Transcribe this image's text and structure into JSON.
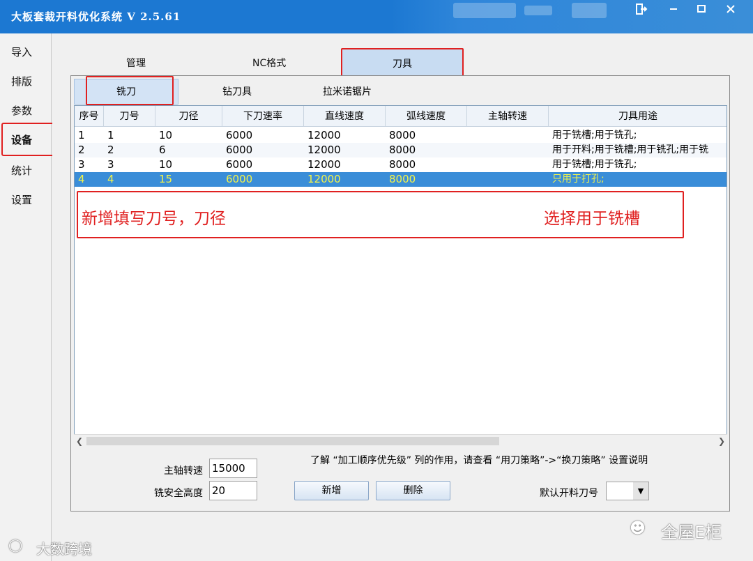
{
  "app": {
    "title": "大板套裁开料优化系统 V 2.5.61",
    "window_controls": [
      "exit-icon",
      "minimize-icon",
      "maximize-icon",
      "close-icon"
    ]
  },
  "sidebar": {
    "items": [
      {
        "label": "导入"
      },
      {
        "label": "排版"
      },
      {
        "label": "参数"
      },
      {
        "label": "设备"
      },
      {
        "label": "统计"
      },
      {
        "label": "设置"
      }
    ],
    "selected": "设备"
  },
  "top_tabs": [
    {
      "label": "管理"
    },
    {
      "label": "NC格式"
    },
    {
      "label": "刀具"
    }
  ],
  "sub_tabs": [
    {
      "label": "铣刀"
    },
    {
      "label": "钻刀具"
    },
    {
      "label": "拉米诺锯片"
    }
  ],
  "grid": {
    "columns": [
      "序号",
      "刀号",
      "刀径",
      "下刀速率",
      "直线速度",
      "弧线速度",
      "主轴转速",
      "刀具用途"
    ],
    "rows": [
      {
        "c0": "1",
        "c1": "1",
        "c2": "10",
        "c3": "6000",
        "c4": "12000",
        "c5": "8000",
        "c6": "",
        "c7": "用于铣槽;用于铣孔;"
      },
      {
        "c0": "2",
        "c1": "2",
        "c2": "6",
        "c3": "6000",
        "c4": "12000",
        "c5": "8000",
        "c6": "",
        "c7": "用于开料;用于铣槽;用于铣孔;用于铣"
      },
      {
        "c0": "3",
        "c1": "3",
        "c2": "10",
        "c3": "6000",
        "c4": "12000",
        "c5": "8000",
        "c6": "",
        "c7": "用于铣槽;用于铣孔;"
      },
      {
        "c0": "4",
        "c1": "4",
        "c2": "15",
        "c3": "6000",
        "c4": "12000",
        "c5": "8000",
        "c6": "",
        "c7": "只用于打孔;"
      }
    ],
    "selected_row": 4
  },
  "annotations": {
    "left": "新增填写刀号，刀径",
    "right": "选择用于铣槽"
  },
  "controls": {
    "spindle_label": "主轴转速",
    "spindle_value": "15000",
    "safe_height_label": "铣安全高度",
    "safe_height_value": "20",
    "add_label": "新增",
    "delete_label": "删除",
    "info_text": "了解 “加工顺序优先级” 列的作用，请查看 “用刀策略”->“换刀策略” 设置说明",
    "default_tool_label": "默认开料刀号",
    "default_tool_value": ""
  },
  "watermarks": {
    "bottom_left": "大数跨境",
    "bottom_right": "全屋E柜"
  },
  "colors": {
    "titlebar": "#1c78d2",
    "selected_row": "#3a8dd8",
    "selected_row_text": "#f3f34a",
    "annotation": "#e02020"
  }
}
